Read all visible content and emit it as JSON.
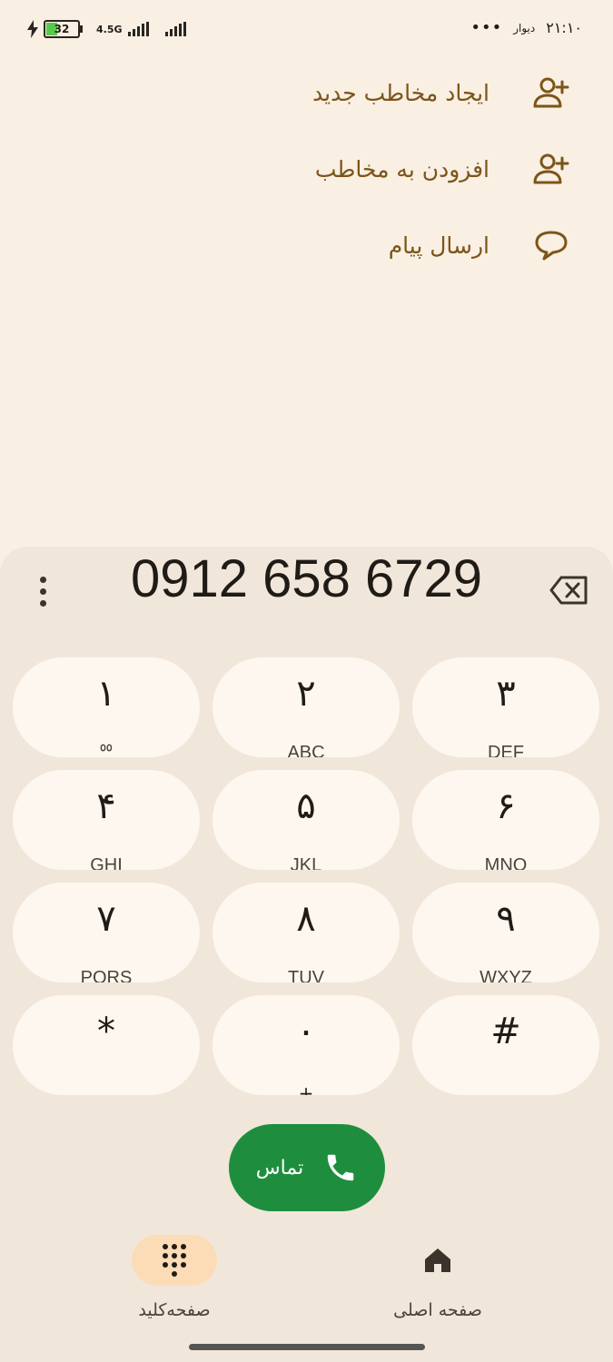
{
  "status_bar": {
    "battery": "32",
    "network": "4.5G",
    "time": "۲۱:۱۰",
    "app": "دیوار",
    "more": "•••"
  },
  "actions": [
    {
      "label": "ایجاد مخاطب جدید",
      "icon": "person-add-icon"
    },
    {
      "label": "افزودن به مخاطب",
      "icon": "person-add-icon"
    },
    {
      "label": "ارسال پیام",
      "icon": "message-icon"
    }
  ],
  "dialer": {
    "number": "0912 658 6729",
    "keys": [
      {
        "digit": "۱",
        "letters": "ᅇ"
      },
      {
        "digit": "۲",
        "letters": "ABC"
      },
      {
        "digit": "۳",
        "letters": "DEF"
      },
      {
        "digit": "۴",
        "letters": "GHI"
      },
      {
        "digit": "۵",
        "letters": "JKL"
      },
      {
        "digit": "۶",
        "letters": "MNO"
      },
      {
        "digit": "۷",
        "letters": "PQRS"
      },
      {
        "digit": "۸",
        "letters": "TUV"
      },
      {
        "digit": "۹",
        "letters": "WXYZ"
      },
      {
        "digit": "*",
        "letters": ""
      },
      {
        "digit": "۰",
        "letters": "+"
      },
      {
        "digit": "#",
        "letters": ""
      }
    ],
    "call_label": "تماس"
  },
  "nav": {
    "keypad_label": "صفحه‌کلید",
    "home_label": "صفحه اصلی"
  },
  "colors": {
    "background": "#f9efe3",
    "sheet": "#f1e6da",
    "key": "#fdf7ef",
    "accent": "#7b5519",
    "call": "#1e8e3e",
    "active_nav": "#fbdcb6"
  }
}
